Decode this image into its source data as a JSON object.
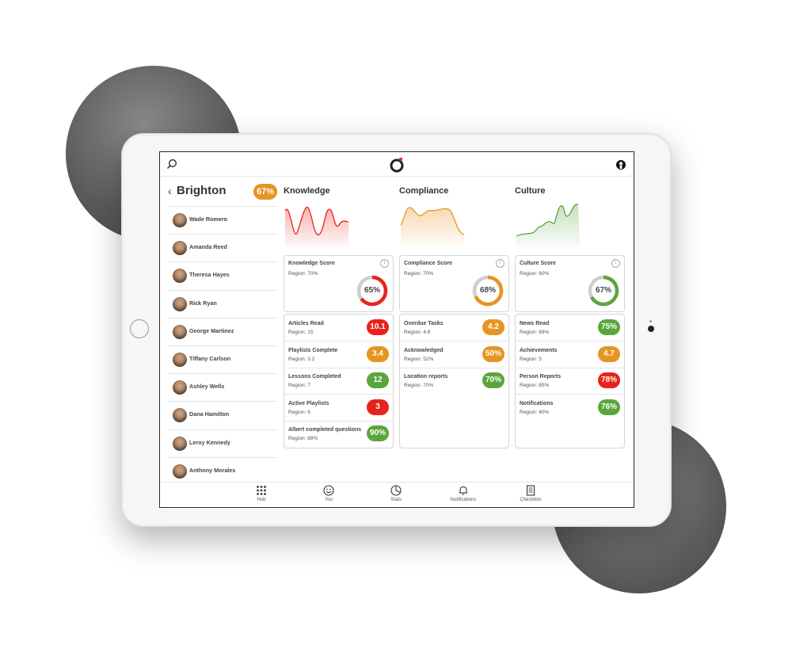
{
  "colors": {
    "red": "#e8231b",
    "orange": "#e69522",
    "green": "#5aa63c"
  },
  "sidebar": {
    "title": "Brighton",
    "score": "67%",
    "people": [
      "Wade Romero",
      "Amanda Reed",
      "Theresa Hayes",
      "Rick Ryan",
      "George Martinez",
      "Tiffany Carlson",
      "Ashley Wells",
      "Dana Hamilton",
      "Leroy Kennedy",
      "Anthony Morales"
    ]
  },
  "columns": [
    {
      "title": "Knowledge",
      "score_title": "Knowledge Score",
      "score_region": "Region: 70%",
      "score_value": "65%",
      "score_fraction": 0.65,
      "color": "#e8231b",
      "metrics": [
        {
          "name": "Articles Read",
          "region": "Region: 15",
          "value": "10.1",
          "color": "#e8231b"
        },
        {
          "name": "Playlists Complete",
          "region": "Region: 3.2",
          "value": "3.4",
          "color": "#e69522"
        },
        {
          "name": "Lessons Completed",
          "region": "Region: 7",
          "value": "12",
          "color": "#5aa63c"
        },
        {
          "name": "Active Playlists",
          "region": "Region: 6",
          "value": "3",
          "color": "#e8231b"
        },
        {
          "name": "Albert completed questions",
          "region": "Region: 88%",
          "value": "90%",
          "color": "#5aa63c"
        }
      ]
    },
    {
      "title": "Compliance",
      "score_title": "Compliance Score",
      "score_region": "Region: 70%",
      "score_value": "68%",
      "score_fraction": 0.68,
      "color": "#e69522",
      "metrics": [
        {
          "name": "Overdue Tasks",
          "region": "Region: 4.8",
          "value": "4.2",
          "color": "#e69522"
        },
        {
          "name": "Acknowledged",
          "region": "Region: 52%",
          "value": "50%",
          "color": "#e69522"
        },
        {
          "name": "Location reports",
          "region": "Region: 70%",
          "value": "70%",
          "color": "#5aa63c"
        }
      ]
    },
    {
      "title": "Culture",
      "score_title": "Culture Score",
      "score_region": "Region: 60%",
      "score_value": "67%",
      "score_fraction": 0.67,
      "color": "#5aa63c",
      "metrics": [
        {
          "name": "News Read",
          "region": "Region: 69%",
          "value": "75%",
          "color": "#5aa63c"
        },
        {
          "name": "Achievements",
          "region": "Region: 5",
          "value": "4.7",
          "color": "#e69522"
        },
        {
          "name": "Person Reports",
          "region": "Region: 85%",
          "value": "78%",
          "color": "#e8231b"
        },
        {
          "name": "Notifications",
          "region": "Region: 60%",
          "value": "76%",
          "color": "#5aa63c"
        }
      ]
    }
  ],
  "tabs": [
    {
      "label": "Hub",
      "icon": "grid-icon"
    },
    {
      "label": "You",
      "icon": "smiley-icon"
    },
    {
      "label": "Stats",
      "icon": "pie-chart-icon"
    },
    {
      "label": "Notifications",
      "icon": "bell-icon"
    },
    {
      "label": "Checklists",
      "icon": "checklist-icon"
    }
  ]
}
